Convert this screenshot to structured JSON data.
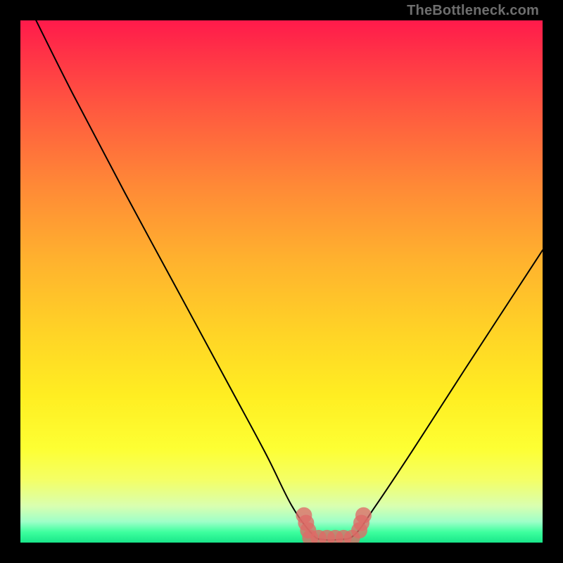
{
  "attribution": "TheBottleneck.com",
  "chart_data": {
    "type": "line",
    "title": "",
    "xlabel": "",
    "ylabel": "",
    "xlim": [
      0,
      100
    ],
    "ylim": [
      0,
      100
    ],
    "series": [
      {
        "name": "bottleneck-curve",
        "x": [
          3,
          10,
          20,
          30,
          40,
          47,
          52,
          56,
          58,
          61,
          64,
          68,
          75,
          85,
          100
        ],
        "values": [
          100,
          86,
          67,
          48.5,
          30,
          17,
          7,
          1.5,
          0.6,
          0.6,
          1.5,
          7,
          17.5,
          33,
          56
        ]
      }
    ],
    "optimal_band": {
      "x_start": 55.5,
      "x_end": 64.5,
      "y": 0.9,
      "dot_radius": 1.55,
      "dot_spacing": 1.6,
      "color": "#df6a66"
    },
    "gradient_colors": {
      "top": "#ff1a4b",
      "mid_upper": "#ff8a36",
      "mid": "#ffd426",
      "mid_lower": "#fdff33",
      "bottom": "#19e78a"
    }
  }
}
